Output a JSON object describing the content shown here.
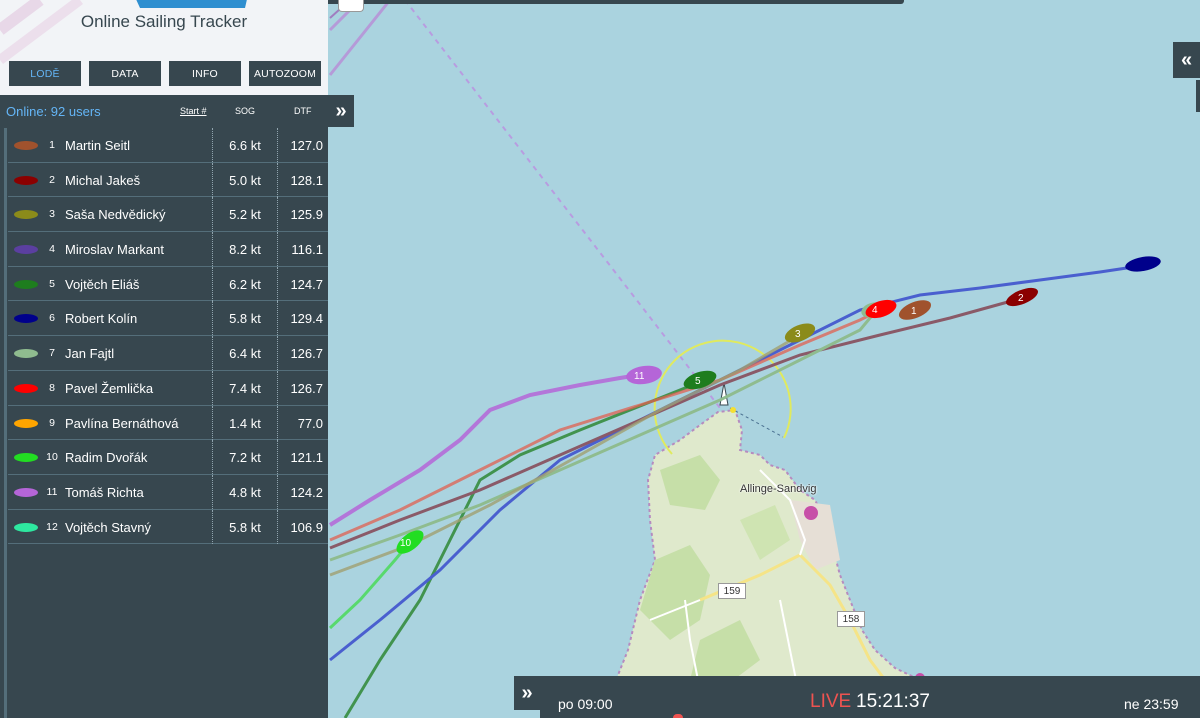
{
  "app": {
    "title": "Online Sailing Tracker"
  },
  "nav_buttons": [
    {
      "label": "LODĚ",
      "active": true
    },
    {
      "label": "DATA",
      "active": false
    },
    {
      "label": "INFO",
      "active": false
    },
    {
      "label": "AUTOZOOM",
      "active": false
    }
  ],
  "list_header": {
    "online": "Online: 92 users",
    "start": "Start #",
    "sog": "SOG",
    "dtf": "DTF",
    "collapse_icon": "»"
  },
  "boats": [
    {
      "num": "1",
      "name": "Martin Seitl",
      "sog": "6.6 kt",
      "dtf": "127.0",
      "color": "#a0522d"
    },
    {
      "num": "2",
      "name": "Michal Jakeš",
      "sog": "5.0 kt",
      "dtf": "128.1",
      "color": "#8b0000"
    },
    {
      "num": "3",
      "name": "Saša Nedvědický",
      "sog": "5.2 kt",
      "dtf": "125.9",
      "color": "#8b8b1a"
    },
    {
      "num": "4",
      "name": "Miroslav Markant",
      "sog": "8.2 kt",
      "dtf": "116.1",
      "color": "#5b3fa0"
    },
    {
      "num": "5",
      "name": "Vojtěch Eliáš",
      "sog": "6.2 kt",
      "dtf": "124.7",
      "color": "#1e7d1e"
    },
    {
      "num": "6",
      "name": "Robert Kolín",
      "sog": "5.8 kt",
      "dtf": "129.4",
      "color": "#00008b"
    },
    {
      "num": "7",
      "name": "Jan Fajtl",
      "sog": "6.4 kt",
      "dtf": "126.7",
      "color": "#8fbc8f"
    },
    {
      "num": "8",
      "name": "Pavel Žemlička",
      "sog": "7.4 kt",
      "dtf": "126.7",
      "color": "#ff0000"
    },
    {
      "num": "9",
      "name": "Pavlína Bernáthová",
      "sog": "1.4 kt",
      "dtf": "77.0",
      "color": "#ffa500"
    },
    {
      "num": "10",
      "name": "Radim Dvořák",
      "sog": "7.2 kt",
      "dtf": "121.1",
      "color": "#22dd22"
    },
    {
      "num": "11",
      "name": "Tomáš Richta",
      "sog": "4.8 kt",
      "dtf": "124.2",
      "color": "#b565d8"
    },
    {
      "num": "12",
      "name": "Vojtěch Stavný",
      "sog": "5.8 kt",
      "dtf": "106.9",
      "color": "#2ee8a0"
    }
  ],
  "map": {
    "town": "Allinge-Sandvig",
    "roads": [
      "159",
      "158"
    ],
    "expand_icon": "«"
  },
  "timebar": {
    "expand_icon": "»",
    "start": "po 09:00",
    "live": "LIVE",
    "now": "15:21:37",
    "end": "ne 23:59"
  }
}
